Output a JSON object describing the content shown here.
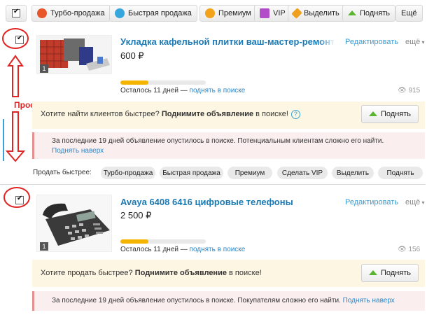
{
  "toolbar": {
    "turbo": "Турбо-продажа",
    "fast": "Быстрая продажа",
    "premium": "Премиум",
    "vip": "VIP",
    "highlight": "Выделить",
    "raise": "Поднять",
    "more": "Ещё"
  },
  "annotation": {
    "label": "Проставляет прога"
  },
  "listings": [
    {
      "title": "Укладка кафельной плитки ваш-мастер-ремонт",
      "price": "600 ₽",
      "edit": "Редактировать",
      "more": "ещё",
      "remaining": "Осталось 11 дней —",
      "raise_link": "поднять в поиске",
      "progress": 0.33,
      "views": "915",
      "photo_count": "1",
      "promo_text": "Хотите найти клиентов быстрее?",
      "promo_bold": "Поднимите объявление",
      "promo_tail": "в поиске!",
      "promo_button": "Поднять",
      "warning_text": "За последние 19 дней объявление опустилось в поиске. Потенциальным клиентам сложно его найти.",
      "warning_link": "Поднять наверх"
    },
    {
      "title": "Avaya 6408 6416 цифровые телефоны",
      "price": "2 500 ₽",
      "edit": "Редактировать",
      "more": "ещё",
      "remaining": "Осталось 11 дней —",
      "raise_link": "поднять в поиске",
      "progress": 0.33,
      "views": "156",
      "photo_count": "1",
      "promo_text": "Хотите продать быстрее?",
      "promo_bold": "Поднимите объявление",
      "promo_tail": "в поиске!",
      "promo_button": "Поднять",
      "warning_text": "За последние 19 дней объявление опустилось в поиске. Покупателям сложно его найти.",
      "warning_link": "Поднять наверх"
    }
  ],
  "sell_faster": {
    "label": "Продать быстрее:",
    "options": [
      "Турбо-продажа",
      "Быстрая продажа",
      "Премиум",
      "Сделать VIP",
      "Выделить",
      "Поднять"
    ]
  },
  "colors": {
    "accent": "#1a7ab5",
    "annotation": "#e02424",
    "progress": "#f5b400",
    "raise_arrow": "#5cb531"
  }
}
